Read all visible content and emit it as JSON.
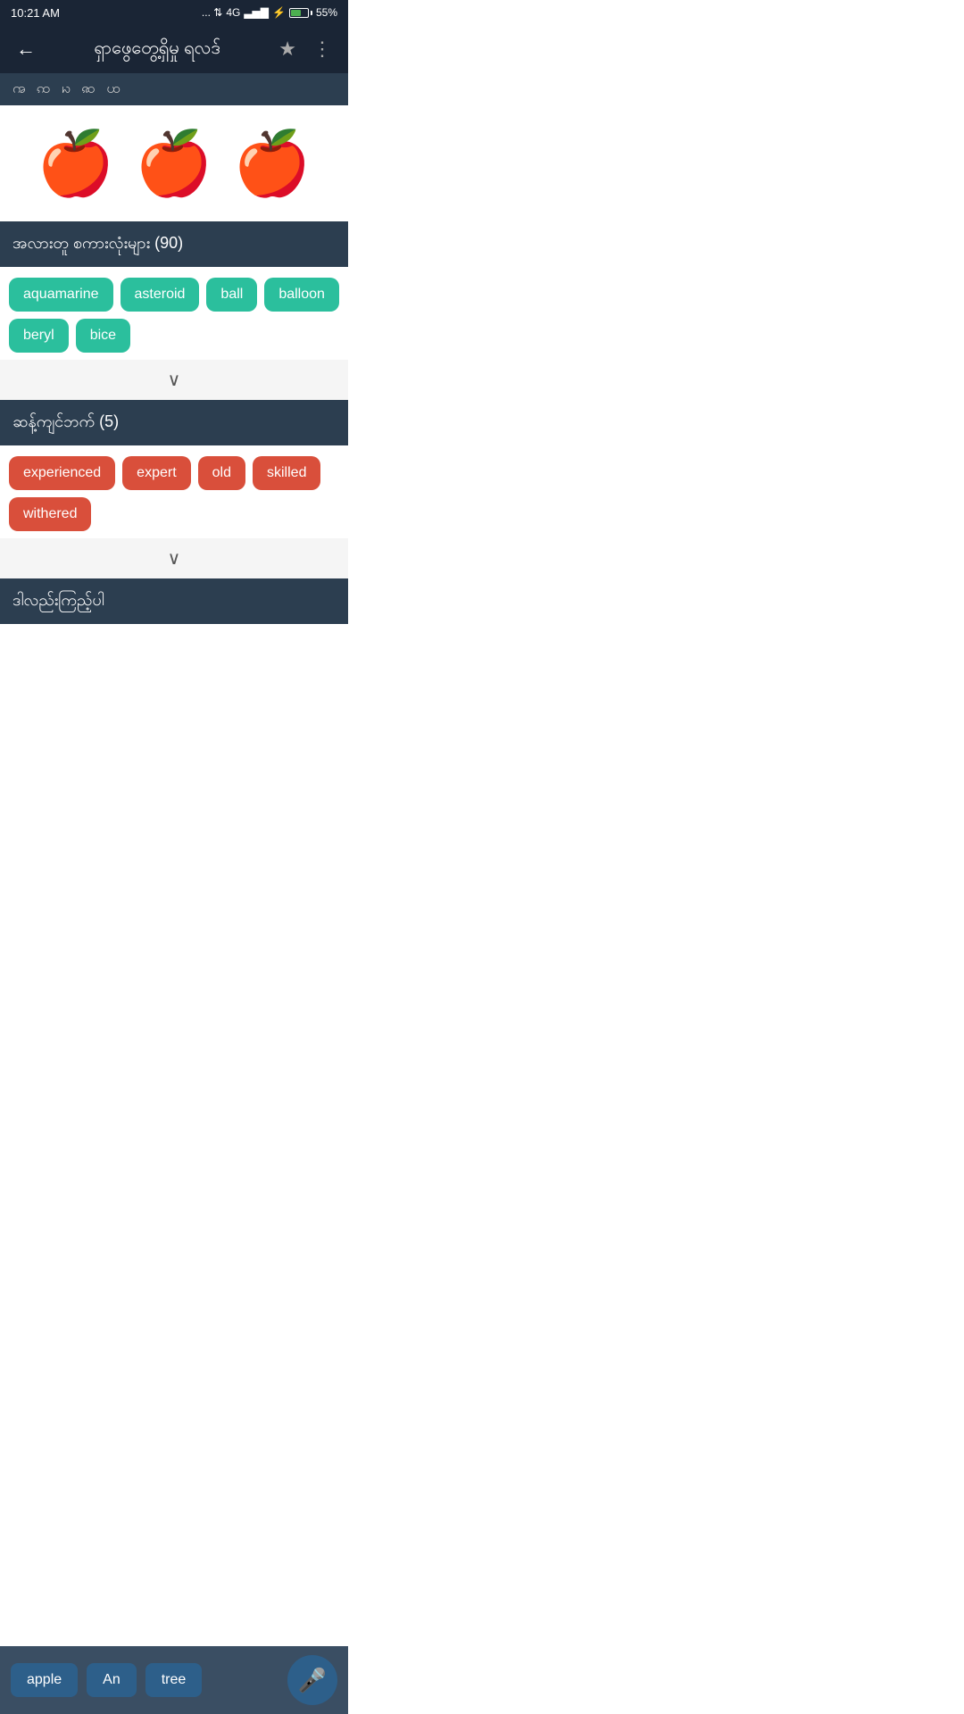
{
  "statusBar": {
    "time": "10:21 AM",
    "signal": "4G",
    "battery": "55%",
    "charging": true
  },
  "nav": {
    "title": "ရှာဖွေတွေ့ရှိမှု ရလဒ်",
    "back_label": "←",
    "star_icon": "★",
    "menu_icon": "⋮"
  },
  "keyboardBar": {
    "content": "ꩠ  ꩡ  ꩢ  ꩣ  ꩤ"
  },
  "appleSection": {
    "icons": [
      "🍎",
      "🍎",
      "🍎"
    ]
  },
  "relatedSection": {
    "header": "အလားတူ စကားလုံးများ (90)",
    "tags": [
      "aquamarine",
      "asteroid",
      "ball",
      "balloon",
      "beryl",
      "bice"
    ]
  },
  "synonymSection": {
    "header": "ဆန့်ကျင်ဘက် (5)",
    "tags": [
      "experienced",
      "expert",
      "old",
      "skilled",
      "withered"
    ]
  },
  "examplesSection": {
    "header": "ဒါလည်းကြည့်ပါ"
  },
  "suggestions": {
    "items": [
      "apple",
      "An",
      "tree"
    ]
  },
  "chevron": "∨"
}
